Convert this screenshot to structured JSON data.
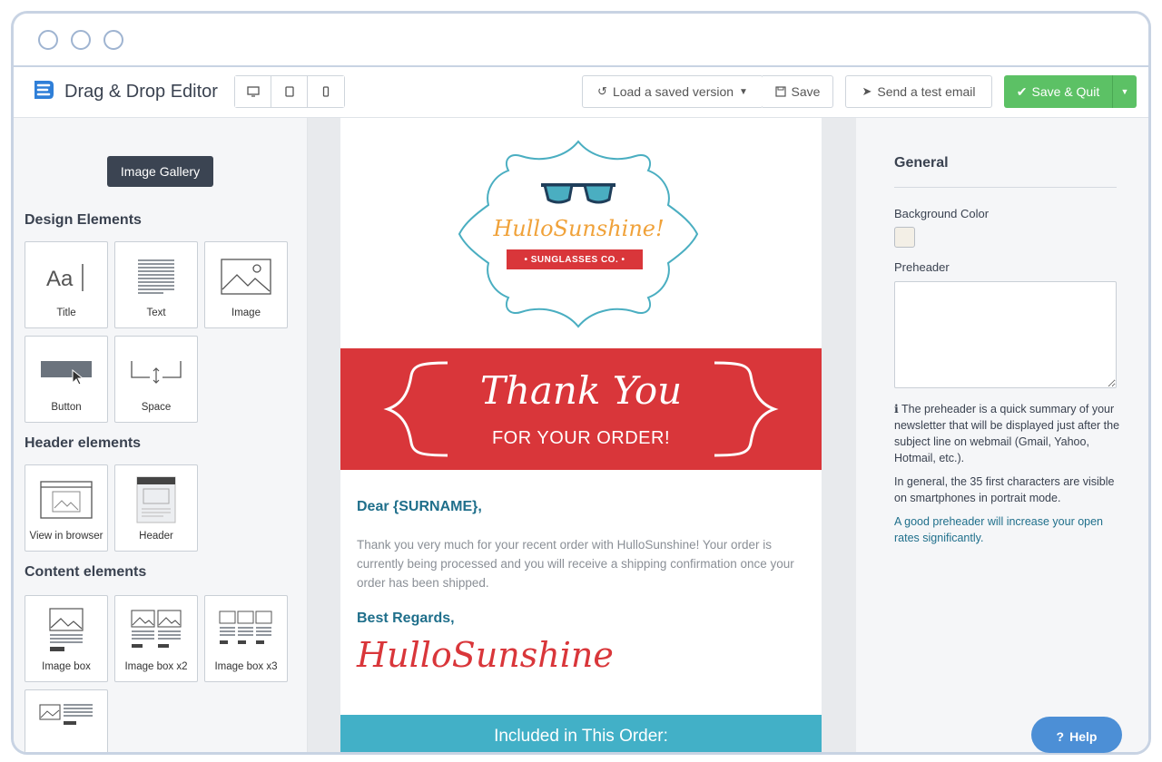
{
  "window": {
    "controls": [
      "close",
      "minimize",
      "maximize"
    ]
  },
  "toolbar": {
    "brand_name": "Drag & Drop Editor",
    "devices": [
      "desktop-icon",
      "tablet-icon",
      "mobile-icon"
    ],
    "load_version_label": "Load a saved version",
    "save_label": "Save",
    "test_email_label": "Send a test email",
    "save_quit_label": "Save & Quit"
  },
  "left_panel": {
    "gallery_label": "Image Gallery",
    "design_title": "Design Elements",
    "design_items": [
      "Title",
      "Text",
      "Image",
      "Button",
      "Space"
    ],
    "header_title": "Header elements",
    "header_items": [
      "View in browser",
      "Header"
    ],
    "content_title": "Content elements",
    "content_items": [
      "Image box",
      "Image box x2",
      "Image box x3"
    ]
  },
  "email": {
    "logo_text": "HulloSunshine!",
    "logo_ribbon": "• SUNGLASSES CO. •",
    "banner_title": "Thank You",
    "banner_sub": "FOR YOUR ORDER!",
    "greeting": "Dear {SURNAME},",
    "body": "Thank you very much for your recent order with HulloSunshine! Your order is currently being processed and you will receive a shipping confirmation once your order has been shipped.",
    "regards": "Best Regards,",
    "signature": "HulloSunshine",
    "included": "Included in This Order:"
  },
  "right_panel": {
    "title": "General",
    "bg_color_label": "Background Color",
    "bg_color_value": "#f3efe6",
    "preheader_label": "Preheader",
    "preheader_value": "",
    "info_text": "The preheader is a quick summary of your newsletter that will be displayed just after the subject line on webmail (Gmail, Yahoo, Hotmail, etc.).",
    "general_text": "In general, the 35 first characters are visible on smartphones in portrait mode.",
    "tip_link": "A good preheader will increase your open rates significantly."
  },
  "help_label": "Help",
  "colors": {
    "accent_green": "#5cc165",
    "brand_red": "#d9363a",
    "teal": "#42b0c7",
    "link": "#1f6f8b"
  }
}
